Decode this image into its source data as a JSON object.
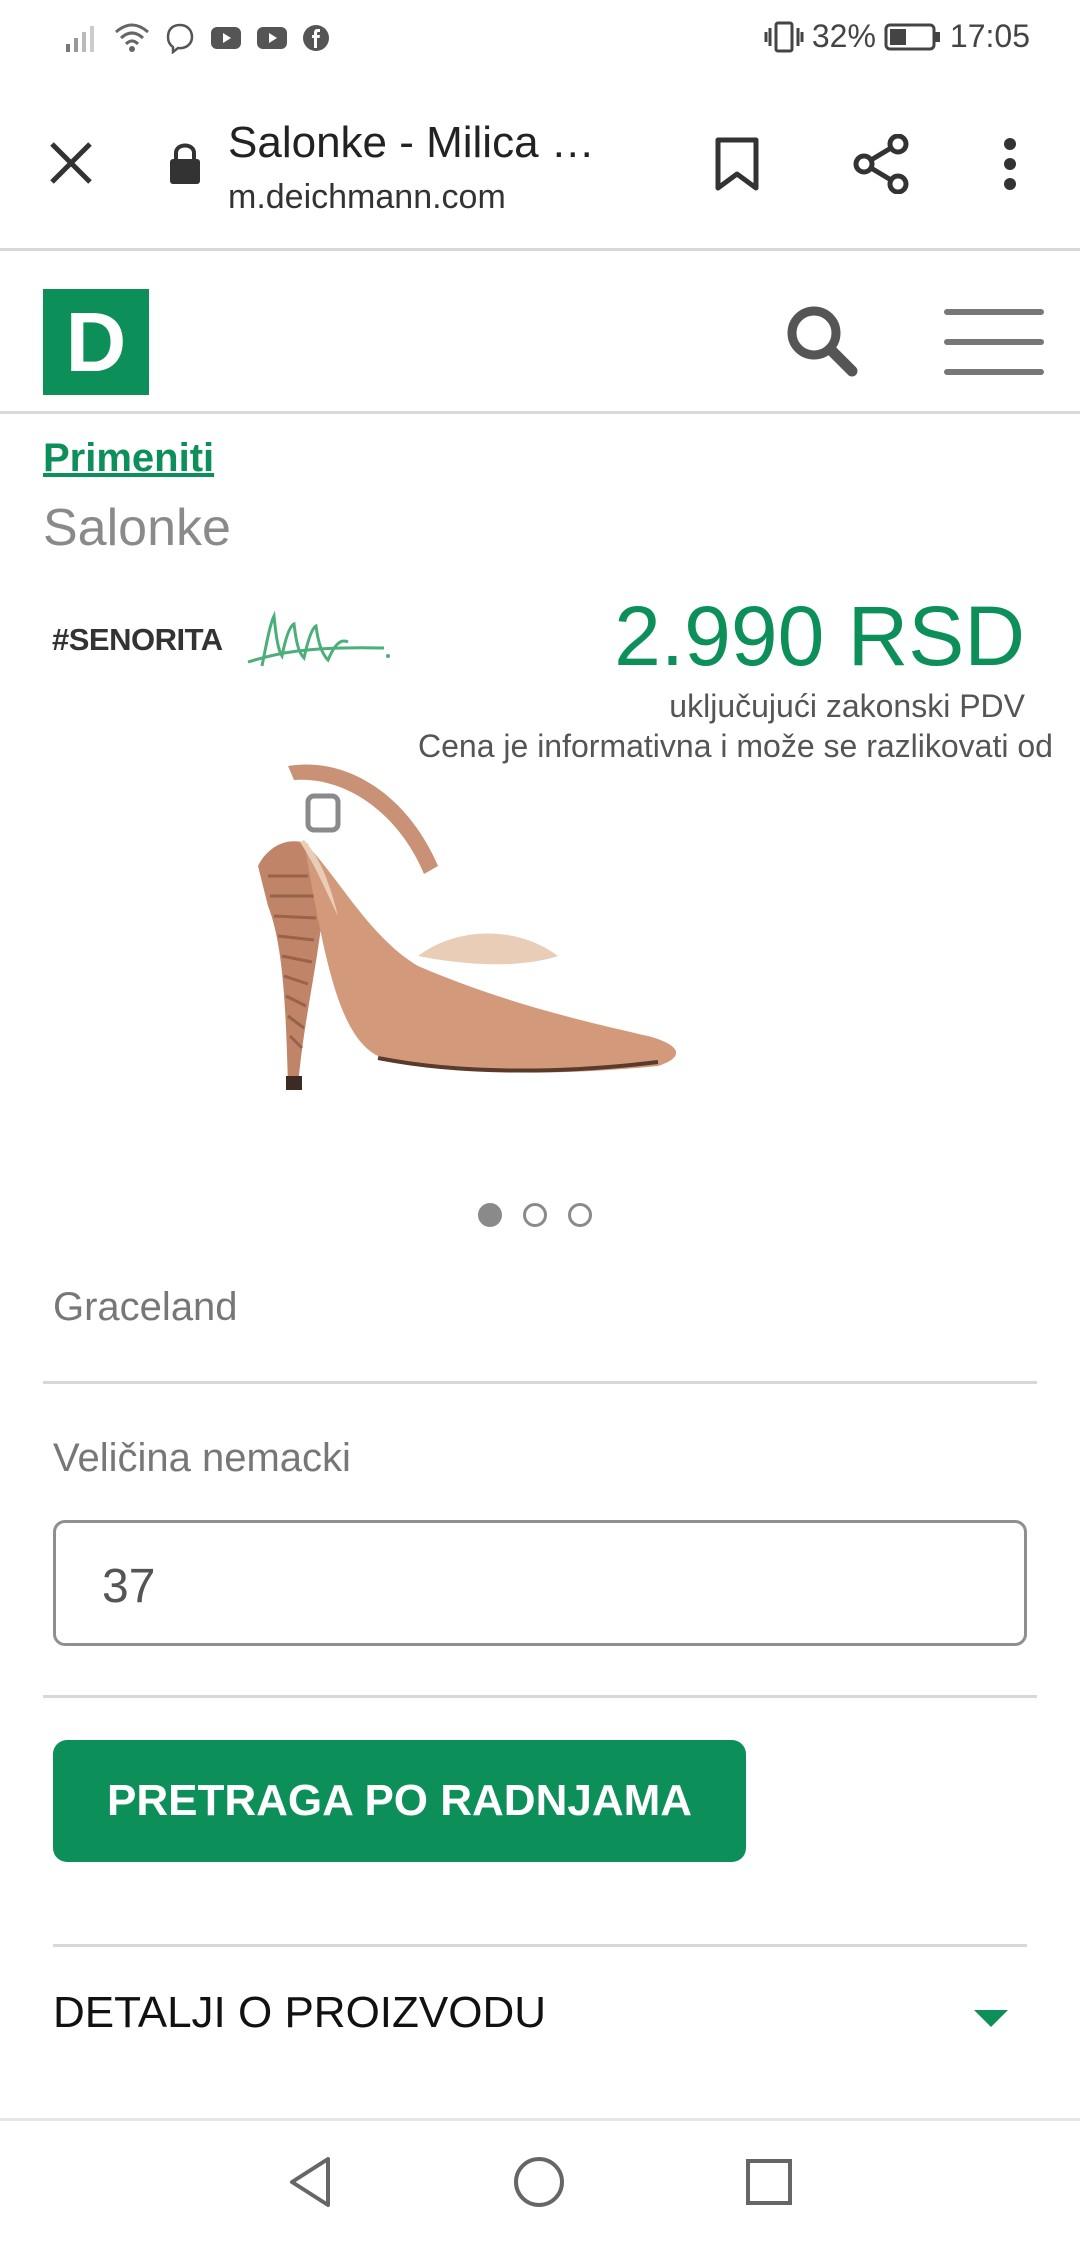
{
  "status_bar": {
    "battery": "32%",
    "time": "17:05",
    "icons": [
      "signal-icon",
      "wifi-icon",
      "viber-icon",
      "youtube-icon",
      "youtube-icon",
      "facebook-icon",
      "vibrate-icon",
      "battery-icon"
    ]
  },
  "browser": {
    "title": "Salonke - Milica …",
    "url": "m.deichmann.com",
    "icons": [
      "close-icon",
      "lock-icon",
      "bookmark-icon",
      "share-icon",
      "more-vertical-icon"
    ]
  },
  "site": {
    "logo_letter": "D",
    "icons": [
      "search-icon",
      "menu-icon"
    ]
  },
  "product": {
    "breadcrumb": "Primeniti",
    "category": "Salonke",
    "hashtag": "#SENORITA",
    "price": "2.990 RSD",
    "vat_note": "uključujući zakonski PDV",
    "info_note": "Cena je informativna i može se razlikovati od",
    "brand": "Graceland",
    "image_count": 3,
    "image_active": 1
  },
  "size": {
    "label": "Veličina nemacki",
    "value": "37"
  },
  "actions": {
    "search_button": "PRETRAGA PO RADNJAMA",
    "details_label": "DETALJI O PROIZVODU"
  },
  "colors": {
    "brand_green": "#0c8f59"
  }
}
